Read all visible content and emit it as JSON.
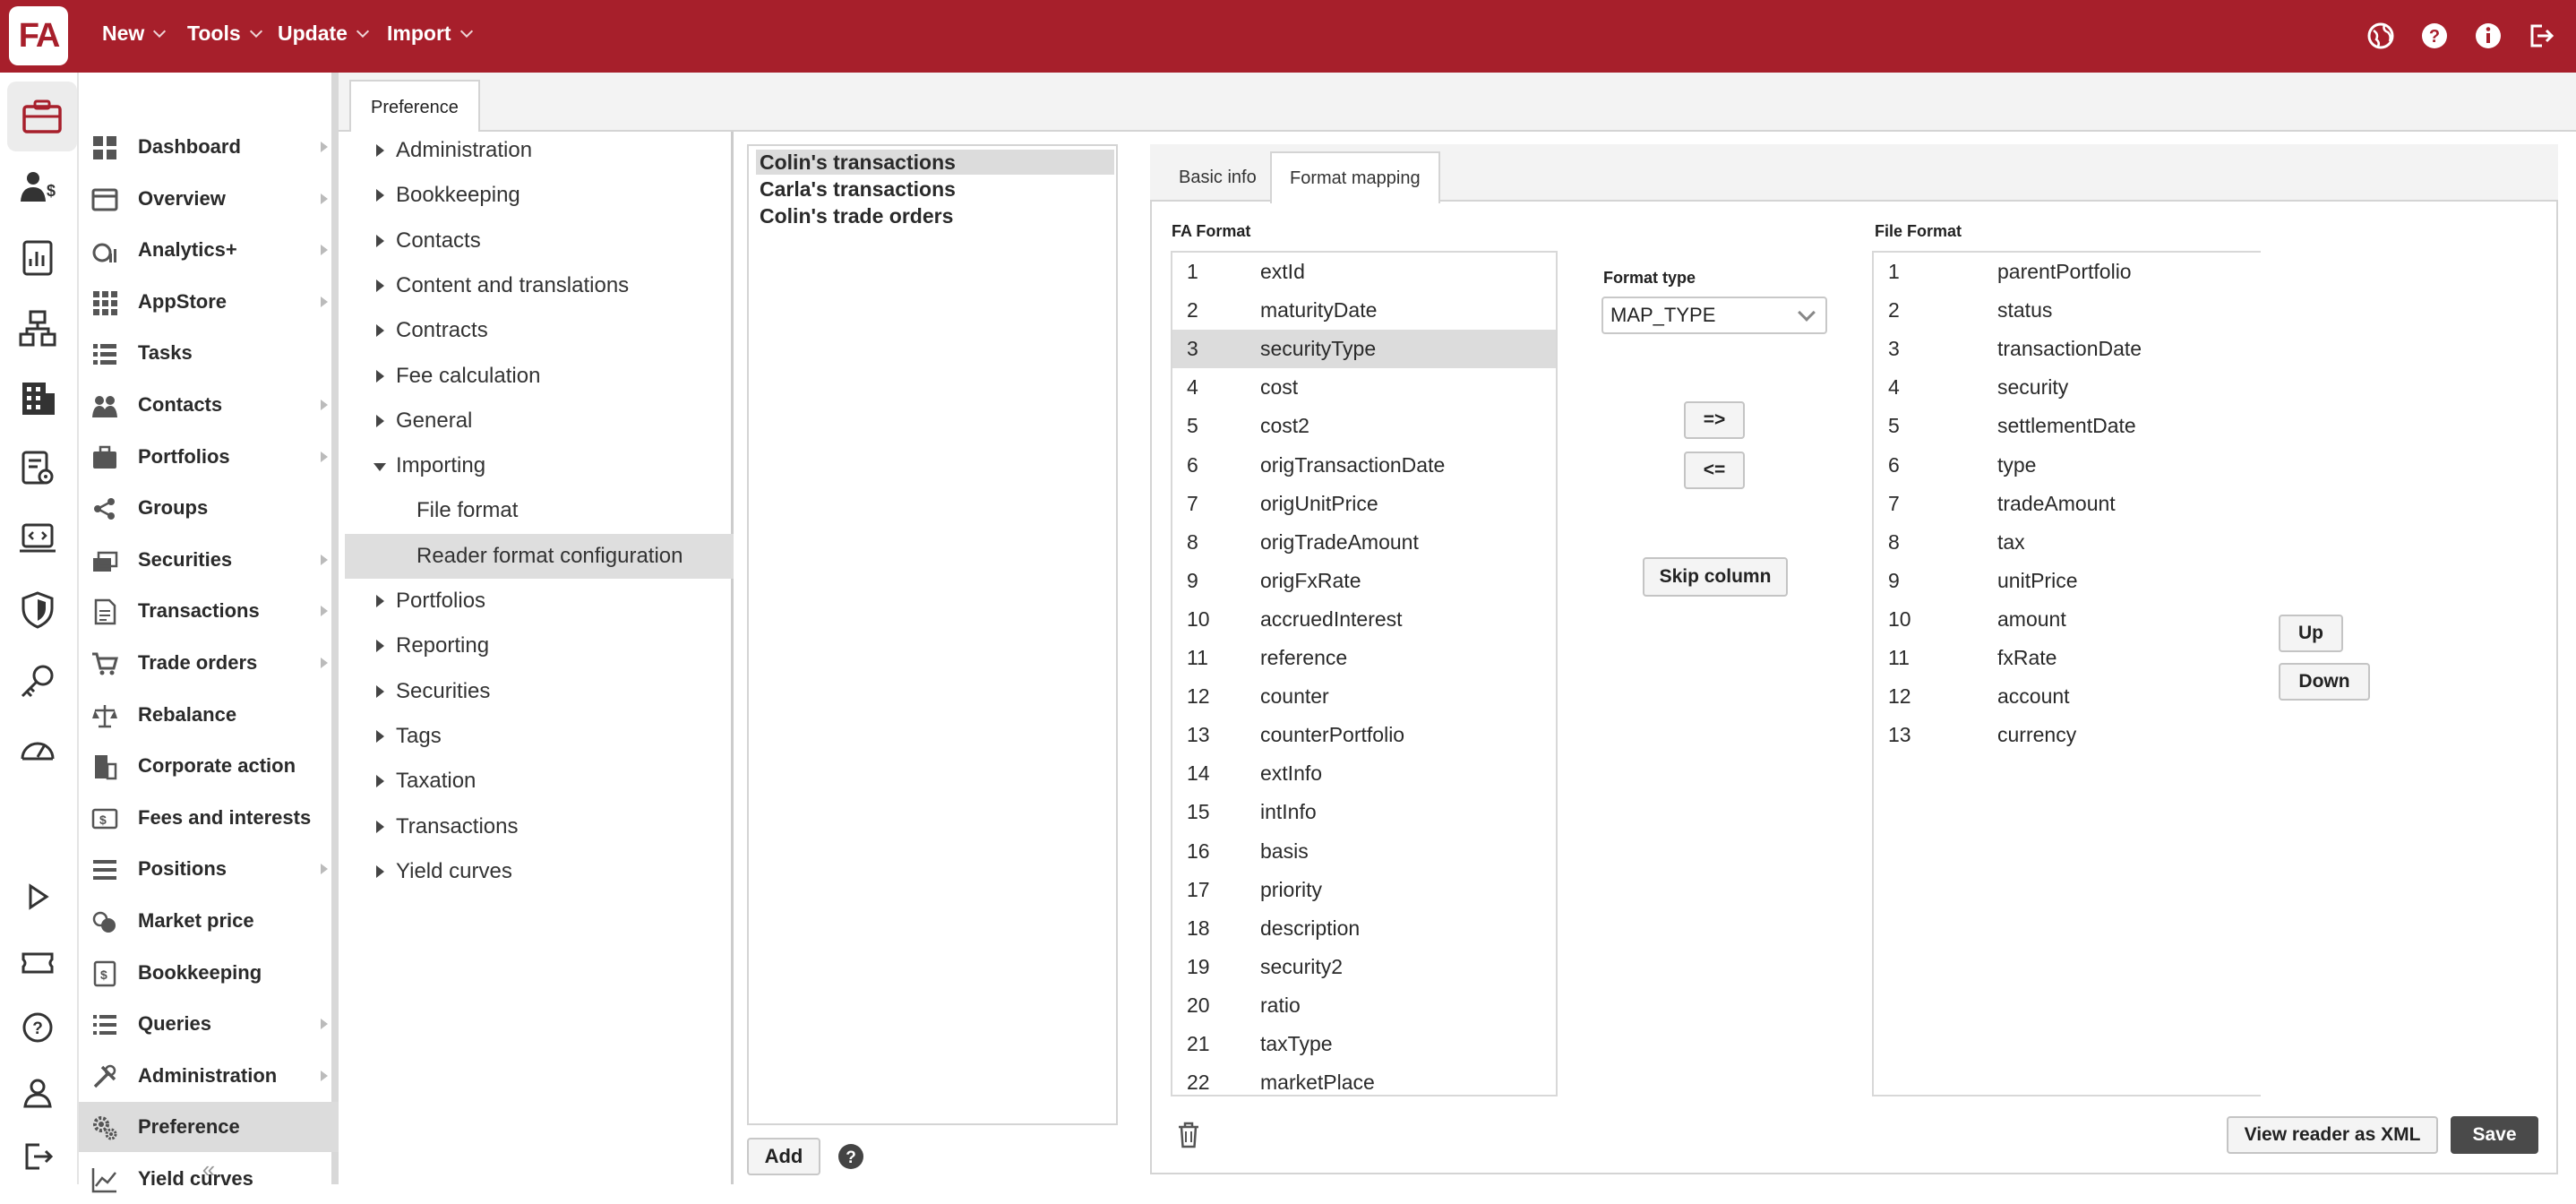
{
  "app": {
    "logo": "FA"
  },
  "topmenu": [
    {
      "label": "New"
    },
    {
      "label": "Tools"
    },
    {
      "label": "Update"
    },
    {
      "label": "Import"
    }
  ],
  "topicons": [
    "globe-icon",
    "help-icon",
    "info-icon",
    "logout-icon"
  ],
  "sidebar": {
    "items": [
      {
        "label": "Dashboard",
        "icon": "dashboard-icon",
        "arrow": true
      },
      {
        "label": "Overview",
        "icon": "overview-icon",
        "arrow": true
      },
      {
        "label": "Analytics+",
        "icon": "analytics-icon",
        "arrow": true
      },
      {
        "label": "AppStore",
        "icon": "appstore-icon",
        "arrow": true
      },
      {
        "label": "Tasks",
        "icon": "tasks-icon",
        "arrow": false
      },
      {
        "label": "Contacts",
        "icon": "contacts-icon",
        "arrow": true
      },
      {
        "label": "Portfolios",
        "icon": "portfolios-icon",
        "arrow": true
      },
      {
        "label": "Groups",
        "icon": "groups-icon",
        "arrow": false
      },
      {
        "label": "Securities",
        "icon": "securities-icon",
        "arrow": true
      },
      {
        "label": "Transactions",
        "icon": "transactions-icon",
        "arrow": true
      },
      {
        "label": "Trade orders",
        "icon": "cart-icon",
        "arrow": true
      },
      {
        "label": "Rebalance",
        "icon": "scale-icon",
        "arrow": false
      },
      {
        "label": "Corporate action",
        "icon": "corporate-action-icon",
        "arrow": false
      },
      {
        "label": "Fees and interests",
        "icon": "fees-icon",
        "arrow": false
      },
      {
        "label": "Positions",
        "icon": "positions-icon",
        "arrow": true
      },
      {
        "label": "Market price",
        "icon": "market-price-icon",
        "arrow": false
      },
      {
        "label": "Bookkeeping",
        "icon": "bookkeeping-icon",
        "arrow": false
      },
      {
        "label": "Queries",
        "icon": "queries-icon",
        "arrow": true
      },
      {
        "label": "Administration",
        "icon": "tools-icon",
        "arrow": true
      },
      {
        "label": "Preference",
        "icon": "gears-icon",
        "arrow": false,
        "active": true
      },
      {
        "label": "Yield curves",
        "icon": "line-chart-icon",
        "arrow": false
      }
    ],
    "collapse": "«"
  },
  "main_tab": "Preference",
  "tree": {
    "nodes": [
      {
        "label": "Administration",
        "type": "closed"
      },
      {
        "label": "Bookkeeping",
        "type": "closed"
      },
      {
        "label": "Contacts",
        "type": "closed"
      },
      {
        "label": "Content and translations",
        "type": "closed"
      },
      {
        "label": "Contracts",
        "type": "closed"
      },
      {
        "label": "Fee calculation",
        "type": "closed"
      },
      {
        "label": "General",
        "type": "closed"
      },
      {
        "label": "Importing",
        "type": "open"
      },
      {
        "label": "File format",
        "type": "child"
      },
      {
        "label": "Reader format configuration",
        "type": "child",
        "selected": true
      },
      {
        "label": "Portfolios",
        "type": "closed"
      },
      {
        "label": "Reporting",
        "type": "closed"
      },
      {
        "label": "Securities",
        "type": "closed"
      },
      {
        "label": "Tags",
        "type": "closed"
      },
      {
        "label": "Taxation",
        "type": "closed"
      },
      {
        "label": "Transactions",
        "type": "closed"
      },
      {
        "label": "Yield curves",
        "type": "closed"
      }
    ]
  },
  "readers": {
    "items": [
      "Colin's transactions",
      "Carla's transactions",
      "Colin's trade orders"
    ],
    "selected": 0,
    "add_label": "Add"
  },
  "panel_tabs": [
    {
      "label": "Basic info"
    },
    {
      "label": "Format mapping",
      "active": true
    }
  ],
  "fa_format": {
    "header": "FA Format",
    "selected": 2,
    "rows": [
      {
        "n": "1",
        "field": "extId"
      },
      {
        "n": "2",
        "field": "maturityDate"
      },
      {
        "n": "3",
        "field": "securityType"
      },
      {
        "n": "4",
        "field": "cost"
      },
      {
        "n": "5",
        "field": "cost2"
      },
      {
        "n": "6",
        "field": "origTransactionDate"
      },
      {
        "n": "7",
        "field": "origUnitPrice"
      },
      {
        "n": "8",
        "field": "origTradeAmount"
      },
      {
        "n": "9",
        "field": "origFxRate"
      },
      {
        "n": "10",
        "field": "accruedInterest"
      },
      {
        "n": "11",
        "field": "reference"
      },
      {
        "n": "12",
        "field": "counter"
      },
      {
        "n": "13",
        "field": "counterPortfolio"
      },
      {
        "n": "14",
        "field": "extInfo"
      },
      {
        "n": "15",
        "field": "intInfo"
      },
      {
        "n": "16",
        "field": "basis"
      },
      {
        "n": "17",
        "field": "priority"
      },
      {
        "n": "18",
        "field": "description"
      },
      {
        "n": "19",
        "field": "security2"
      },
      {
        "n": "20",
        "field": "ratio"
      },
      {
        "n": "21",
        "field": "taxType"
      },
      {
        "n": "22",
        "field": "marketPlace"
      }
    ]
  },
  "format_type": {
    "label": "Format type",
    "value": "MAP_TYPE"
  },
  "buttons": {
    "map_right": "=>",
    "map_left": "<=",
    "skip": "Skip column",
    "up": "Up",
    "down": "Down",
    "view_xml": "View reader as XML",
    "save": "Save"
  },
  "file_format": {
    "header": "File Format",
    "rows": [
      {
        "n": "1",
        "field": "parentPortfolio"
      },
      {
        "n": "2",
        "field": "status"
      },
      {
        "n": "3",
        "field": "transactionDate"
      },
      {
        "n": "4",
        "field": "security"
      },
      {
        "n": "5",
        "field": "settlementDate"
      },
      {
        "n": "6",
        "field": "type"
      },
      {
        "n": "7",
        "field": "tradeAmount"
      },
      {
        "n": "8",
        "field": "tax"
      },
      {
        "n": "9",
        "field": "unitPrice"
      },
      {
        "n": "10",
        "field": "amount"
      },
      {
        "n": "11",
        "field": "fxRate"
      },
      {
        "n": "12",
        "field": "account"
      },
      {
        "n": "13",
        "field": "currency"
      }
    ]
  },
  "colors": {
    "brand": "#a71f2b",
    "selection": "#dcdcdc"
  }
}
